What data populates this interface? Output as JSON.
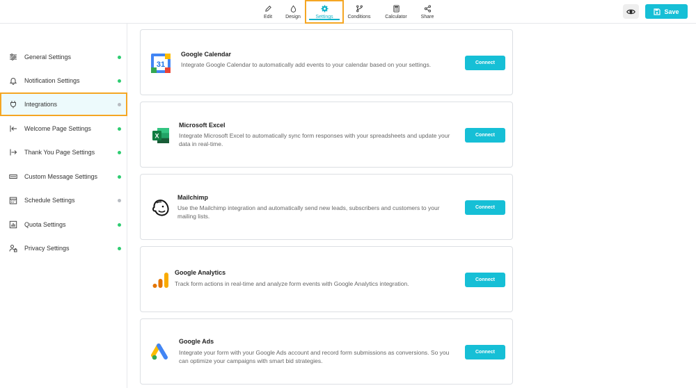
{
  "topnav": [
    {
      "label": "Edit",
      "icon": "pencil-icon"
    },
    {
      "label": "Design",
      "icon": "droplet-icon"
    },
    {
      "label": "Settings",
      "icon": "gear-icon",
      "active": true
    },
    {
      "label": "Conditions",
      "icon": "branch-icon"
    },
    {
      "label": "Calculator",
      "icon": "calculator-icon"
    },
    {
      "label": "Share",
      "icon": "share-icon"
    }
  ],
  "header": {
    "save_label": "Save",
    "preview_icon": "eye-icon"
  },
  "sidebar": {
    "items": [
      {
        "label": "General Settings",
        "icon": "sliders-icon",
        "status_color": "#2ecc71"
      },
      {
        "label": "Notification Settings",
        "icon": "bell-icon",
        "status_color": "#2ecc71"
      },
      {
        "label": "Integrations",
        "icon": "plug-icon",
        "status_color": "#b8bcc2",
        "active": true
      },
      {
        "label": "Welcome Page Settings",
        "icon": "enter-icon",
        "status_color": "#2ecc71"
      },
      {
        "label": "Thank You Page Settings",
        "icon": "exit-icon",
        "status_color": "#2ecc71"
      },
      {
        "label": "Custom Message Settings",
        "icon": "message-icon",
        "status_color": "#2ecc71"
      },
      {
        "label": "Schedule Settings",
        "icon": "calendar-icon",
        "status_color": "#b8bcc2"
      },
      {
        "label": "Quota Settings",
        "icon": "chart-icon",
        "status_color": "#2ecc71"
      },
      {
        "label": "Privacy Settings",
        "icon": "user-lock-icon",
        "status_color": "#2ecc71"
      }
    ]
  },
  "integrations": [
    {
      "name": "Google Calendar",
      "icon": "google-calendar-icon",
      "description": "Integrate Google Calendar to automatically add events to your calendar based on your settings.",
      "button": "Connect"
    },
    {
      "name": "Microsoft Excel",
      "icon": "excel-icon",
      "description": "Integrate Microsoft Excel to automatically sync form responses with your spreadsheets and update your data in real-time.",
      "button": "Connect"
    },
    {
      "name": "Mailchimp",
      "icon": "mailchimp-icon",
      "description": "Use the Mailchimp integration and automatically send new leads, subscribers and customers to your mailing lists.",
      "button": "Connect"
    },
    {
      "name": "Google Analytics",
      "icon": "google-analytics-icon",
      "description": "Track form actions in real-time and analyze form events with Google Analytics integration.",
      "button": "Connect"
    },
    {
      "name": "Google Ads",
      "icon": "google-ads-icon",
      "description": "Integrate your form with your Google Ads account and record form submissions as conversions. So you can optimize your campaigns with smart bid strategies.",
      "button": "Connect"
    }
  ],
  "calendar_icon_text": "31",
  "excel_icon_text": "X",
  "colors": {
    "accent": "#16bfd6",
    "highlight": "#f5a623",
    "status_on": "#2ecc71",
    "status_off": "#b8bcc2"
  }
}
